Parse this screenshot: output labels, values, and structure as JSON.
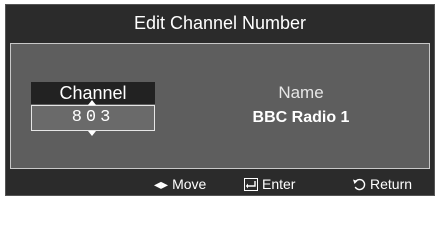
{
  "dialog": {
    "title": "Edit Channel Number",
    "channel": {
      "label": "Channel",
      "value": "803"
    },
    "name": {
      "label": "Name",
      "value": "BBC Radio 1"
    },
    "footer": {
      "move": {
        "icon": "left-right-arrows-icon",
        "label": "Move"
      },
      "enter": {
        "icon": "enter-icon",
        "label": "Enter"
      },
      "return": {
        "icon": "return-icon",
        "label": "Return"
      }
    }
  }
}
